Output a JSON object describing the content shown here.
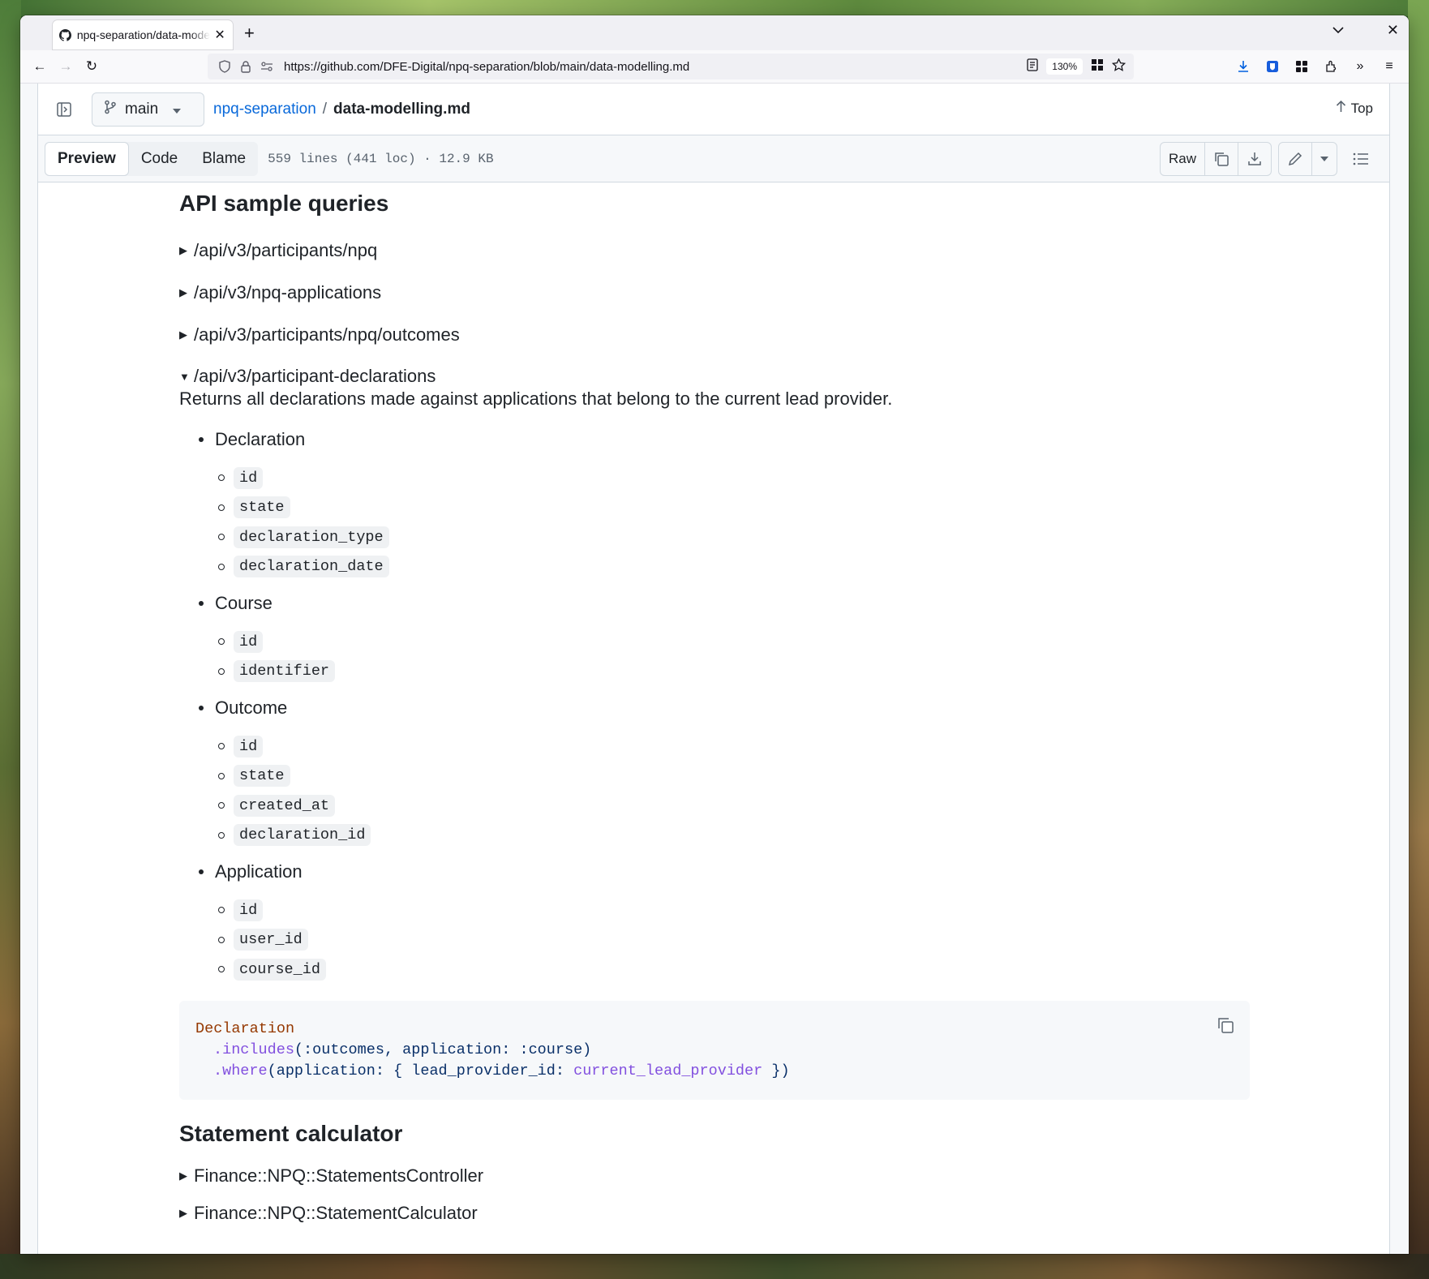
{
  "browser": {
    "tab_title": "npq-separation/data-modelling.md",
    "url": "https://github.com/DFE-Digital/npq-separation/blob/main/data-modelling.md",
    "zoom": "130%"
  },
  "repo_header": {
    "branch": "main",
    "repo": "npq-separation",
    "separator": "/",
    "file": "data-modelling.md",
    "top_label": "Top"
  },
  "file_toolbar": {
    "tabs": [
      "Preview",
      "Code",
      "Blame"
    ],
    "active_tab": "Preview",
    "meta": "559 lines (441 loc) · 12.9 KB",
    "raw_label": "Raw"
  },
  "content": {
    "heading1": "API sample queries",
    "collapsed": [
      "/api/v3/participants/npq",
      "/api/v3/npq-applications",
      "/api/v3/participants/npq/outcomes"
    ],
    "open_summary": "/api/v3/participant-declarations",
    "description": "Returns all declarations made against applications that belong to the current lead provider.",
    "groups": [
      {
        "name": "Declaration",
        "fields": [
          "id",
          "state",
          "declaration_type",
          "declaration_date"
        ]
      },
      {
        "name": "Course",
        "fields": [
          "id",
          "identifier"
        ]
      },
      {
        "name": "Outcome",
        "fields": [
          "id",
          "state",
          "created_at",
          "declaration_id"
        ]
      },
      {
        "name": "Application",
        "fields": [
          "id",
          "user_id",
          "course_id"
        ]
      }
    ],
    "code": {
      "line1_const": "Declaration",
      "line2_method": ".includes",
      "line2_args": "(:outcomes, application: :course)",
      "line3_method": ".where",
      "line3_args_a": "(application: { lead_provider_id: ",
      "line3_var": "current_lead_provider",
      "line3_args_b": " })"
    },
    "heading2": "Statement calculator",
    "statement_items": [
      "Finance::NPQ::StatementsController",
      "Finance::NPQ::StatementCalculator"
    ]
  }
}
